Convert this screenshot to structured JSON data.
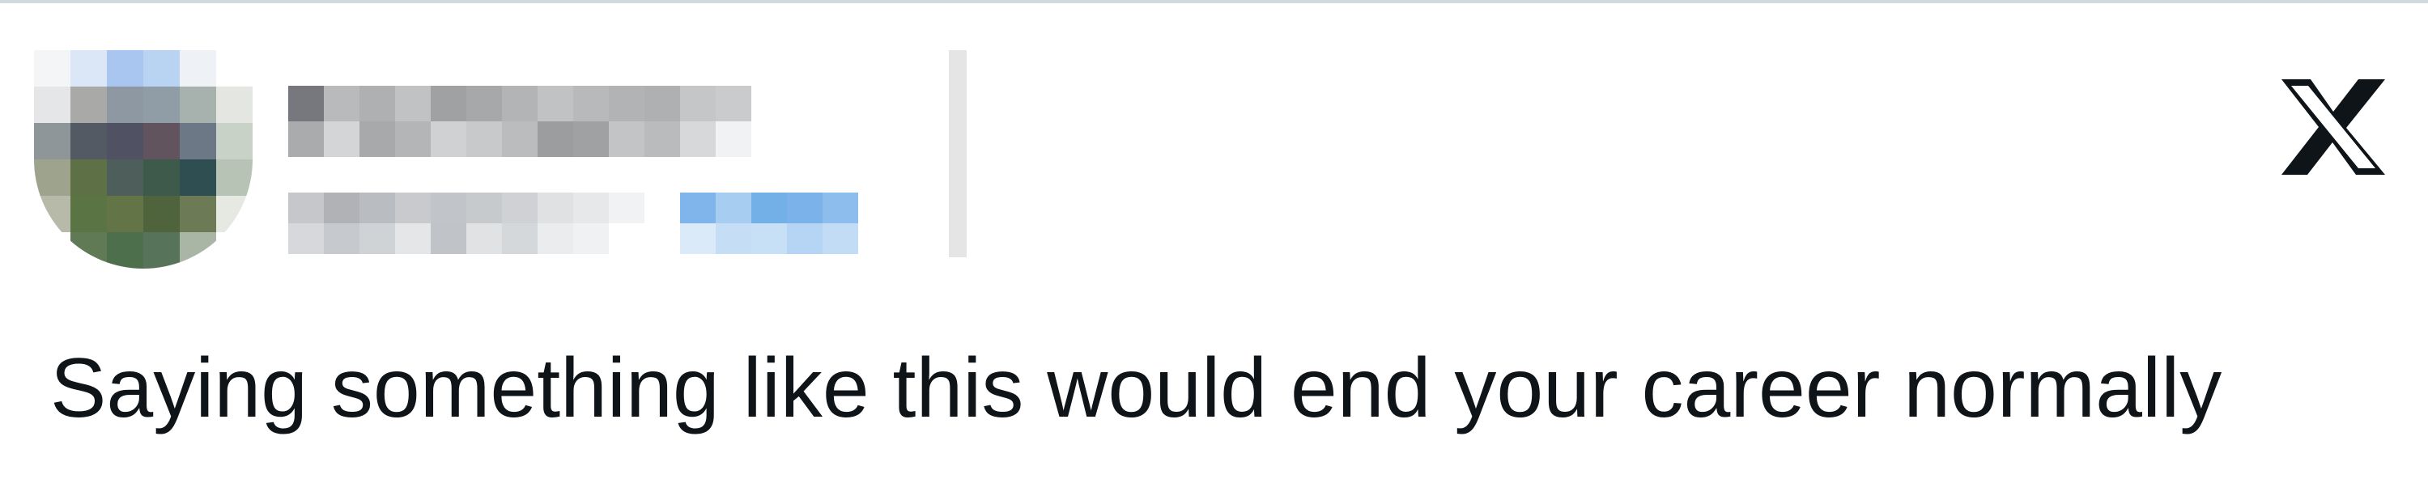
{
  "post": {
    "text": "Saying something like this would end your career normally"
  },
  "header": {
    "avatar_icon": "blurred-avatar",
    "platform_logo_icon": "x-logo-icon"
  },
  "colors": {
    "text": "#0f1419",
    "border": "#cfd9de",
    "link_blue": "#1d9bf0"
  }
}
